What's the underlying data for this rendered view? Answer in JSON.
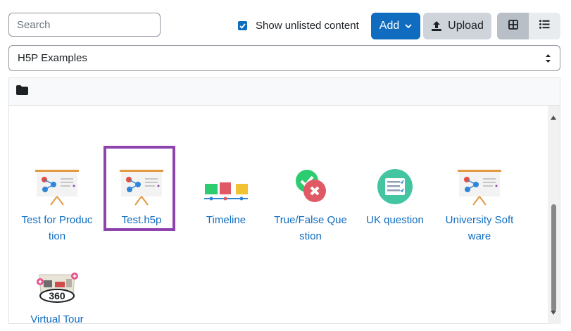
{
  "toolbar": {
    "search_placeholder": "Search",
    "show_unlisted_label": "Show unlisted content",
    "show_unlisted_checked": true,
    "add_label": "Add",
    "upload_label": "Upload"
  },
  "repository_select": {
    "selected": "H5P Examples"
  },
  "files": [
    {
      "name": "Test for Production",
      "display": "Test for Produc\ntion",
      "icon": "presentation-icon"
    },
    {
      "name": "Test.h5p",
      "display": "Test.h5p",
      "icon": "presentation-icon",
      "selected": true
    },
    {
      "name": "Timeline",
      "display": "Timeline",
      "icon": "timeline-icon"
    },
    {
      "name": "True/False Question",
      "display": "True/False Que\nstion",
      "icon": "true-false-icon"
    },
    {
      "name": "UK question",
      "display": "UK question",
      "icon": "question-set-icon"
    },
    {
      "name": "University Software",
      "display": "University Soft\nware",
      "icon": "presentation-icon"
    },
    {
      "name": "Virtual Tour",
      "display": "Virtual Tour",
      "icon": "virtual-tour-360-icon"
    }
  ],
  "colors": {
    "primary": "#0f6cbf",
    "selection_border": "#8e44ad",
    "button_secondary": "#ced4da"
  }
}
